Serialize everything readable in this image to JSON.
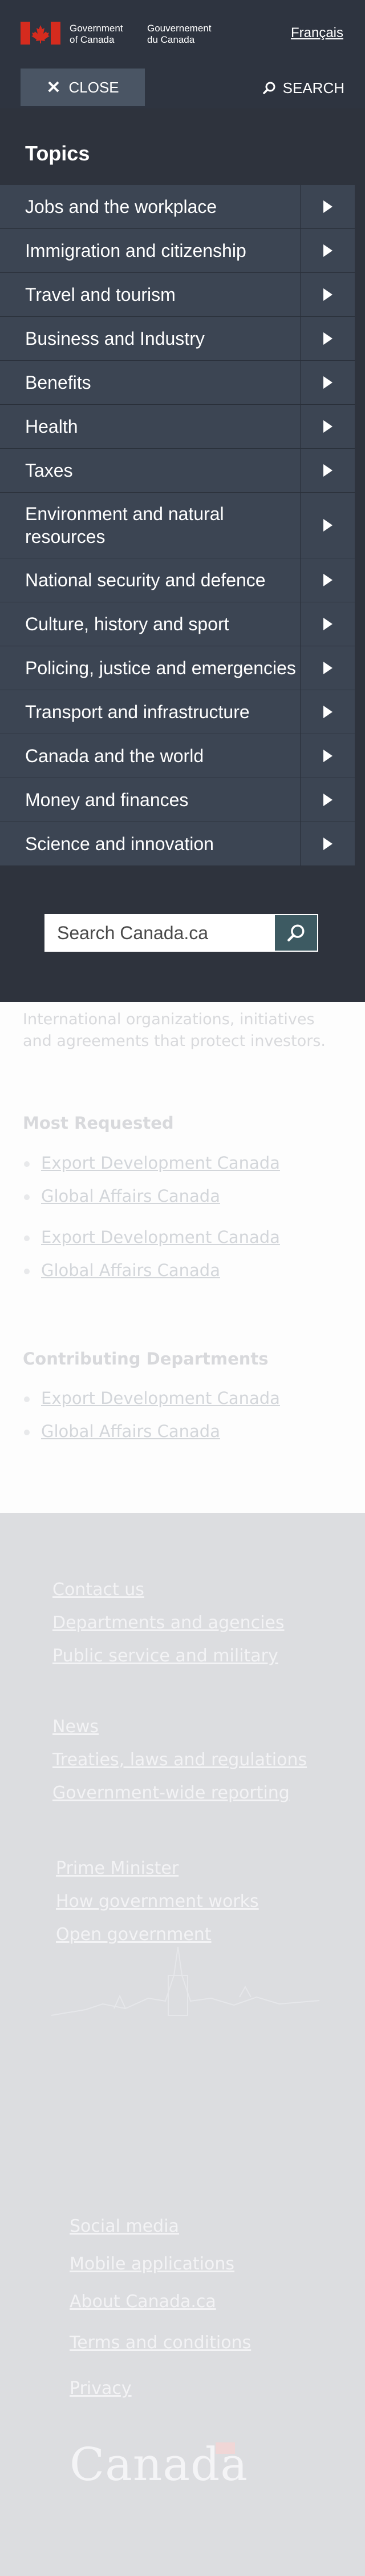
{
  "header": {
    "signature_en_line1": "Government",
    "signature_en_line2": "of Canada",
    "signature_fr_line1": "Gouvernement",
    "signature_fr_line2": "du Canada",
    "language_toggle": "Français"
  },
  "menu_bar": {
    "close_label": "CLOSE",
    "search_label": "SEARCH"
  },
  "menu": {
    "heading": "Topics",
    "topics": [
      "Jobs and the workplace",
      "Immigration and citizenship",
      "Travel and tourism",
      "Business and Industry",
      "Benefits",
      "Health",
      "Taxes",
      "Environment and natural resources",
      "National security and defence",
      "Culture, history and sport",
      "Policing, justice and emergencies",
      "Transport and infrastructure",
      "Canada and the world",
      "Money and finances",
      "Science and innovation"
    ],
    "search_placeholder": "Search Canada.ca"
  },
  "background_page": {
    "intro_text": "International organizations, initiatives and agreements that protect investors.",
    "most_requested_heading": "Most Requested",
    "most_requested_links": [
      "Export Development Canada",
      "Global Affairs Canada",
      "Export Development Canada",
      "Global Affairs Canada"
    ],
    "contributing_heading": "Contributing Departments",
    "contributing_links": [
      "Export Development Canada",
      "Global Affairs Canada"
    ]
  },
  "footer": {
    "group1": [
      "Contact us",
      "Departments and agencies",
      "Public service and military"
    ],
    "group2": [
      "News",
      "Treaties, laws and regulations",
      "Government-wide reporting"
    ],
    "group3": [
      "Prime Minister",
      "How government works",
      "Open government"
    ],
    "group4": [
      "Social media",
      "Mobile applications",
      "About Canada.ca",
      "Terms and conditions",
      "Privacy"
    ],
    "wordmark": "Canada"
  },
  "colors": {
    "header_bg": "#2e3440",
    "menu_bg": "#2e333d",
    "topic_bg": "#3c4553",
    "close_btn_bg": "#4a5564",
    "flag_red": "#d52b1e"
  }
}
